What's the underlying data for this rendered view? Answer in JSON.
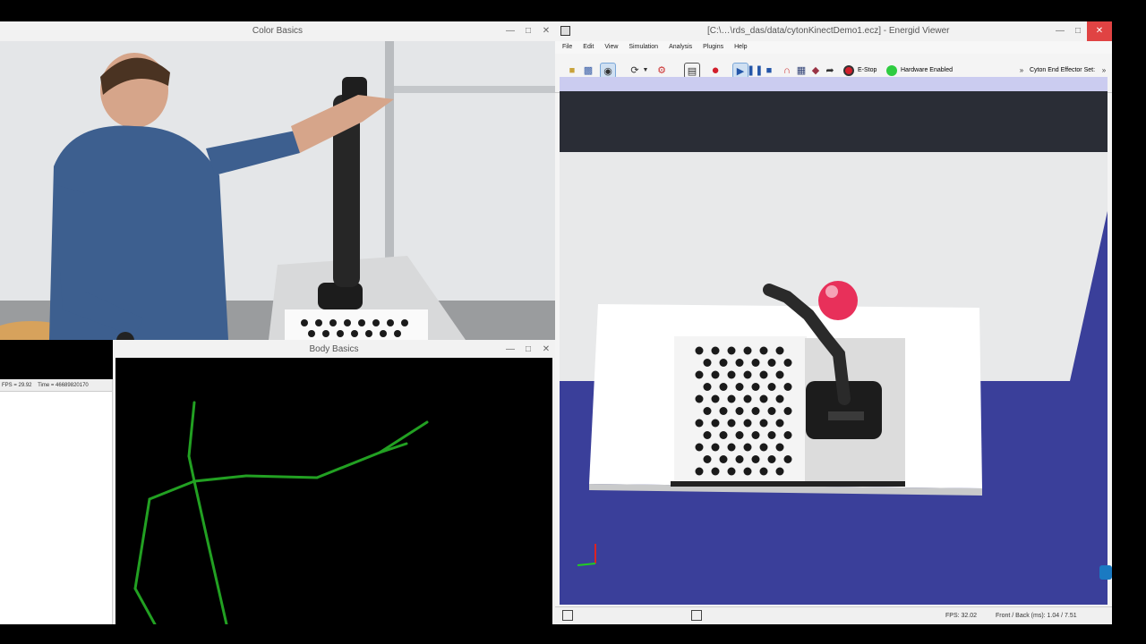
{
  "color_basics": {
    "title": "Color Basics"
  },
  "body_basics": {
    "title": "Body Basics"
  },
  "fps_readout": {
    "fps": "FPS = 29.92",
    "time": "Time = 46689820170"
  },
  "energid": {
    "title": "[C:\\…\\rds_das/data/cytonKinectDemo1.ecz] - Energid Viewer",
    "menu": [
      "File",
      "Edit",
      "View",
      "Simulation",
      "Analysis",
      "Plugins",
      "Help"
    ],
    "estop_label": "E-Stop",
    "hardware_label": "Hardware Enabled",
    "effector_label": "Cyton End Effector Set:",
    "status_fps": "FPS: 32.02",
    "status_front_back": "Front / Back (ms):   1.04 / 7.51"
  },
  "colors": {
    "grid_dot": "#1a1a1a",
    "skeleton": "#22a022",
    "ball": "#e8305a",
    "floor": "#3a3f9a"
  }
}
